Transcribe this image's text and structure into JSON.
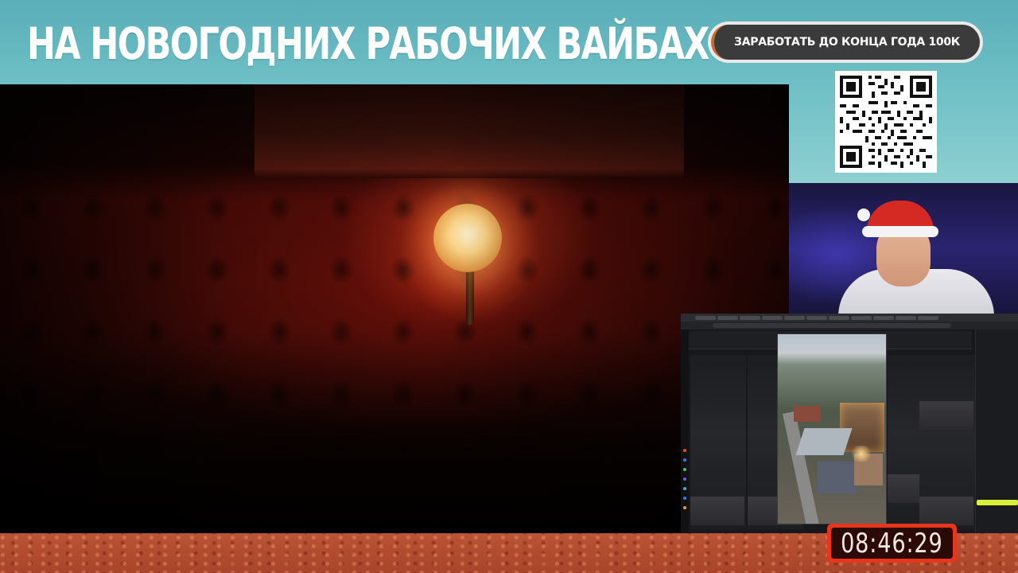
{
  "overlay": {
    "headline": "НА НОВОГОДНИХ РАБОЧИХ ВАЙБАХ",
    "goal": "ЗАРАБОТАТЬ ДО КОНЦА ГОДА 100К",
    "timer": "08:46:29"
  },
  "colors": {
    "sky": "#6fc0c6",
    "ground": "#b24d30",
    "timer_frame": "#e8351e",
    "goal_pill": "#3b3b3b",
    "accent_button": "#d8f03a"
  },
  "icons": {
    "qr": "qr-code",
    "lamp": "wall-lamp"
  }
}
